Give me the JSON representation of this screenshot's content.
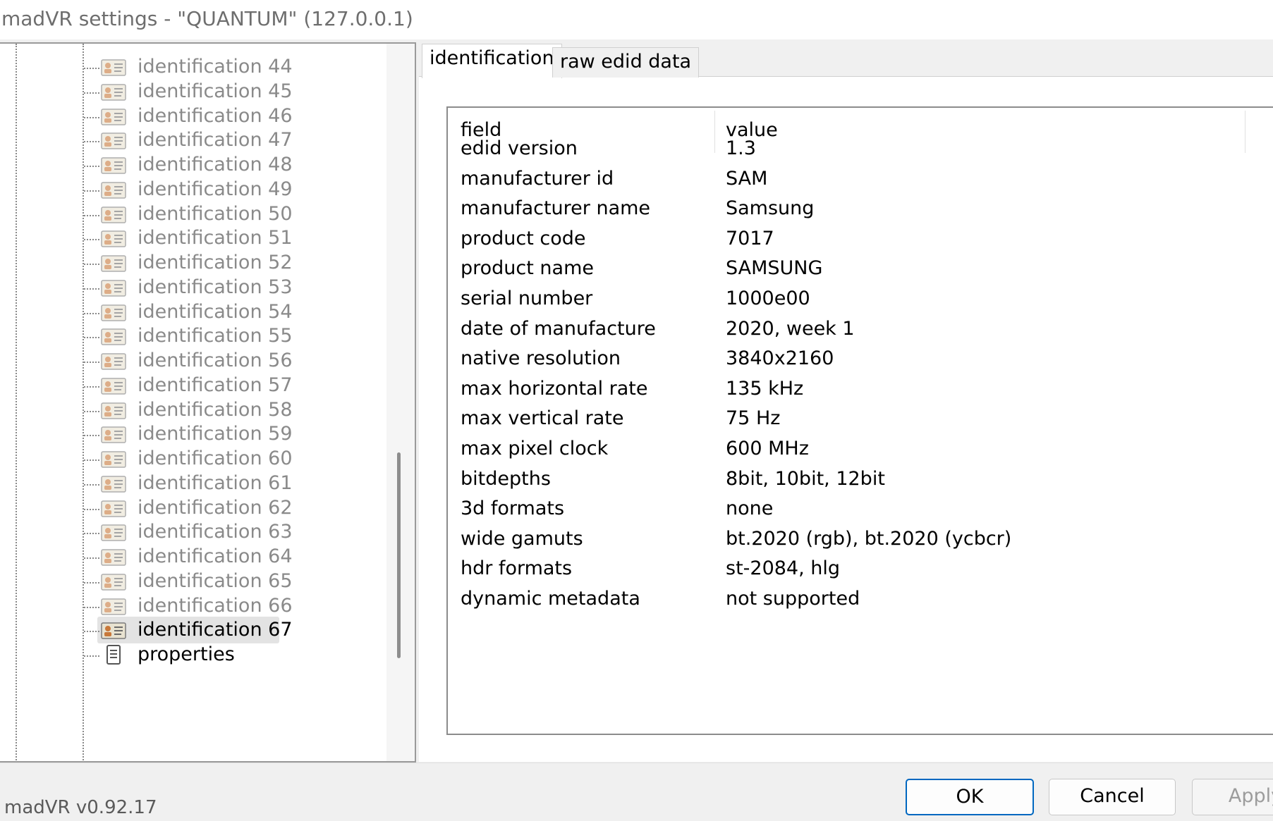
{
  "window": {
    "title": "madVR settings - \"QUANTUM\" (127.0.0.1)"
  },
  "tree": {
    "items": [
      {
        "label": "identification 44"
      },
      {
        "label": "identification 45"
      },
      {
        "label": "identification 46"
      },
      {
        "label": "identification 47"
      },
      {
        "label": "identification 48"
      },
      {
        "label": "identification 49"
      },
      {
        "label": "identification 50"
      },
      {
        "label": "identification 51"
      },
      {
        "label": "identification 52"
      },
      {
        "label": "identification 53"
      },
      {
        "label": "identification 54"
      },
      {
        "label": "identification 55"
      },
      {
        "label": "identification 56"
      },
      {
        "label": "identification 57"
      },
      {
        "label": "identification 58"
      },
      {
        "label": "identification 59"
      },
      {
        "label": "identification 60"
      },
      {
        "label": "identification 61"
      },
      {
        "label": "identification 62"
      },
      {
        "label": "identification 63"
      },
      {
        "label": "identification 64"
      },
      {
        "label": "identification 65"
      },
      {
        "label": "identification 66"
      },
      {
        "label": "identification 67"
      },
      {
        "label": "properties"
      }
    ],
    "selected_label": "identification 67"
  },
  "tabs": [
    {
      "label": "identification",
      "active": true
    },
    {
      "label": "raw edid data",
      "active": false
    }
  ],
  "table": {
    "headers": {
      "field": "field",
      "value": "value"
    },
    "rows": [
      {
        "field": "edid version",
        "value": "1.3"
      },
      {
        "field": "manufacturer id",
        "value": "SAM"
      },
      {
        "field": "manufacturer name",
        "value": "Samsung"
      },
      {
        "field": "product code",
        "value": "7017"
      },
      {
        "field": "product name",
        "value": "SAMSUNG"
      },
      {
        "field": "serial number",
        "value": "1000e00"
      },
      {
        "field": "date of manufacture",
        "value": "2020, week 1"
      },
      {
        "field": "native resolution",
        "value": "3840x2160"
      },
      {
        "field": "max horizontal rate",
        "value": "135 kHz"
      },
      {
        "field": "max vertical rate",
        "value": "75 Hz"
      },
      {
        "field": "max pixel clock",
        "value": "600 MHz"
      },
      {
        "field": "bitdepths",
        "value": "8bit, 10bit, 12bit"
      },
      {
        "field": "3d formats",
        "value": "none"
      },
      {
        "field": "wide gamuts",
        "value": "bt.2020 (rgb), bt.2020 (ycbcr)"
      },
      {
        "field": "hdr formats",
        "value": "st-2084, hlg"
      },
      {
        "field": "dynamic metadata",
        "value": "not supported"
      }
    ]
  },
  "footer": {
    "version": "madVR v0.92.17",
    "ok_label": "OK",
    "cancel_label": "Cancel",
    "apply_label": "Apply"
  },
  "colors": {
    "accent": "#0067c0",
    "disabled_text": "#8a8a8a"
  }
}
